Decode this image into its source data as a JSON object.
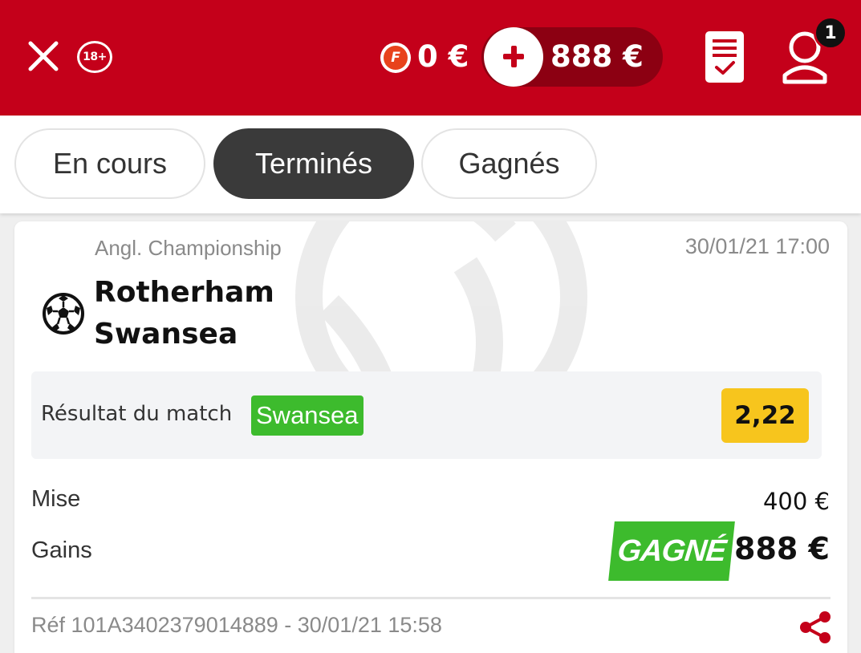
{
  "header": {
    "age_restriction": "18+",
    "freebet_icon_letter": "F",
    "freebet_balance": "0 €",
    "balance": "888 €",
    "notification_count": "1",
    "colors": {
      "background": "#c4001a",
      "balance_pill": "#8c0012"
    }
  },
  "tabs": [
    {
      "label": "En cours",
      "active": false
    },
    {
      "label": "Terminés",
      "active": true
    },
    {
      "label": "Gagnés",
      "active": false
    }
  ],
  "bet": {
    "competition": "Angl. Championship",
    "datetime": "30/01/21 17:00",
    "sport_icon": "soccer-ball-icon",
    "home_team": "Rotherham",
    "away_team": "Swansea",
    "market": "Résultat du match",
    "selection": "Swansea",
    "odds": "2,22",
    "stake_label": "Mise",
    "stake": "400 €",
    "winnings_label": "Gains",
    "status": "GAGNÉ",
    "winnings": "888 €",
    "reference": "Réf 101A3402379014889 - 30/01/21 15:58",
    "colors": {
      "won": "#3dbb2d",
      "odds": "#f7c51d",
      "share": "#c4001a"
    }
  }
}
